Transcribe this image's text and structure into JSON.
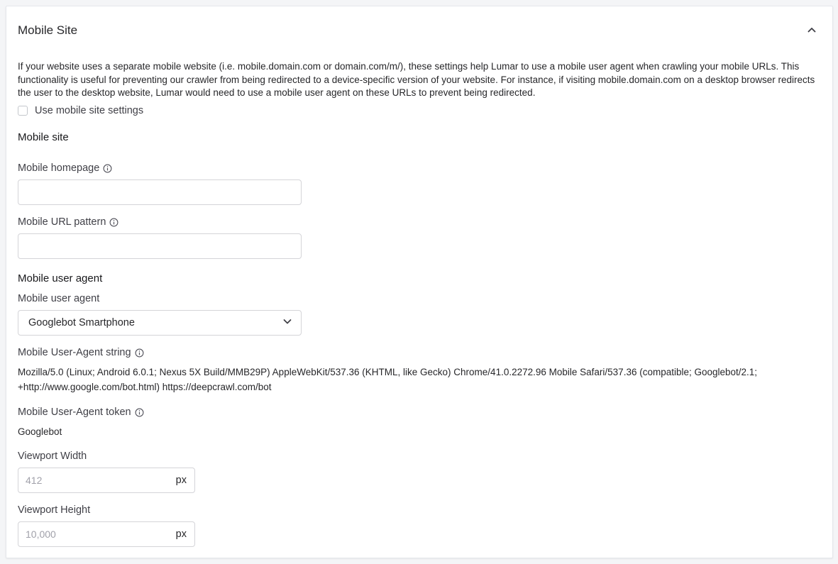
{
  "panel": {
    "title": "Mobile Site",
    "collapse_icon": "chevron-up-icon"
  },
  "description": "If your website uses a separate mobile website (i.e. mobile.domain.com or domain.com/m/), these settings help Lumar to use a mobile user agent when crawling your mobile URLs. This functionality is useful for preventing our crawler from being redirected to a device-specific version of your website. For instance, if visiting mobile.domain.com on a desktop browser redirects the user to the desktop website, Lumar would need to use a mobile user agent on these URLs to prevent being redirected.",
  "use_mobile_settings": {
    "label": "Use mobile site settings",
    "checked": false
  },
  "mobile_site": {
    "heading": "Mobile site",
    "homepage_label": "Mobile homepage",
    "homepage_value": "",
    "url_pattern_label": "Mobile URL pattern",
    "url_pattern_value": ""
  },
  "user_agent": {
    "heading": "Mobile user agent",
    "select_label": "Mobile user agent",
    "selected": "Googlebot Smartphone",
    "string_label": "Mobile User-Agent string",
    "string_value": "Mozilla/5.0 (Linux; Android 6.0.1; Nexus 5X Build/MMB29P) AppleWebKit/537.36 (KHTML, like Gecko) Chrome/41.0.2272.96 Mobile Safari/537.36 (compatible; Googlebot/2.1; +http://www.google.com/bot.html) https://deepcrawl.com/bot",
    "token_label": "Mobile User-Agent token",
    "token_value": "Googlebot"
  },
  "viewport": {
    "width_label": "Viewport Width",
    "width_placeholder": "412",
    "height_label": "Viewport Height",
    "height_placeholder": "10,000",
    "unit": "px"
  },
  "colors": {
    "border": "#d4d4d8",
    "text": "#27272a",
    "muted": "#3f3f46",
    "placeholder": "#a1a1aa"
  }
}
